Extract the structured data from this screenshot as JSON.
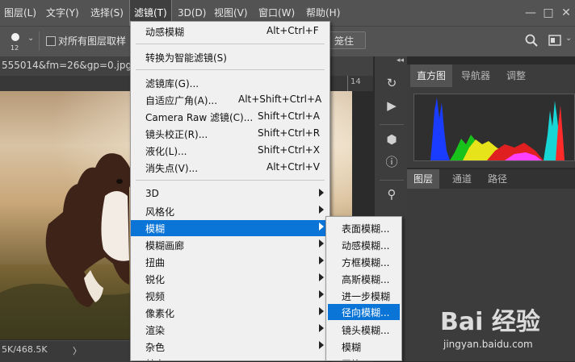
{
  "menubar": {
    "items": [
      {
        "label": "图层(L)"
      },
      {
        "label": "文字(Y)"
      },
      {
        "label": "选择(S)"
      },
      {
        "label": "滤镜(T)"
      },
      {
        "label": "3D(D)"
      },
      {
        "label": "视图(V)"
      },
      {
        "label": "窗口(W)"
      },
      {
        "label": "帮助(H)"
      }
    ],
    "window_controls": [
      "—",
      "□",
      "✕"
    ]
  },
  "options_bar": {
    "brush_size": "12",
    "sample_all_layers_label": "对所有图层取样",
    "partial_button_label": "笼住 ..."
  },
  "document": {
    "tab_title": "555014&fm=26&gp=0.jpg @",
    "ruler_label": "14",
    "status_text": "5K/468.5K",
    "status_arrow": "〉"
  },
  "filter_menu": {
    "items": [
      {
        "label": "动感模糊",
        "shortcut": "Alt+Ctrl+F"
      },
      {
        "label": "转换为智能滤镜(S)",
        "shortcut": ""
      },
      {
        "label": "滤镜库(G)...",
        "shortcut": ""
      },
      {
        "label": "自适应广角(A)...",
        "shortcut": "Alt+Shift+Ctrl+A"
      },
      {
        "label": "Camera Raw 滤镜(C)...",
        "shortcut": "Shift+Ctrl+A"
      },
      {
        "label": "镜头校正(R)...",
        "shortcut": "Shift+Ctrl+R"
      },
      {
        "label": "液化(L)...",
        "shortcut": "Shift+Ctrl+X"
      },
      {
        "label": "消失点(V)...",
        "shortcut": "Alt+Ctrl+V"
      },
      {
        "label": "3D"
      },
      {
        "label": "风格化"
      },
      {
        "label": "模糊"
      },
      {
        "label": "模糊画廊"
      },
      {
        "label": "扭曲"
      },
      {
        "label": "锐化"
      },
      {
        "label": "视频"
      },
      {
        "label": "像素化"
      },
      {
        "label": "渲染"
      },
      {
        "label": "杂色"
      },
      {
        "label": "其它"
      }
    ]
  },
  "blur_submenu": {
    "items": [
      {
        "label": "表面模糊..."
      },
      {
        "label": "动感模糊..."
      },
      {
        "label": "方框模糊..."
      },
      {
        "label": "高斯模糊..."
      },
      {
        "label": "进一步模糊"
      },
      {
        "label": "径向模糊..."
      },
      {
        "label": "镜头模糊..."
      },
      {
        "label": "模糊"
      },
      {
        "label": "平均"
      }
    ]
  },
  "panels": {
    "top_tabs": [
      {
        "label": "直方图"
      },
      {
        "label": "导航器"
      },
      {
        "label": "调整"
      }
    ],
    "bottom_tabs": [
      {
        "label": "图层"
      },
      {
        "label": "通道"
      },
      {
        "label": "路径"
      }
    ]
  },
  "watermark": {
    "logo": "Bai 经验",
    "url": "jingyan.baidu.com"
  },
  "colors": {
    "highlight": "#0b74d7",
    "menubar": "#535353"
  }
}
